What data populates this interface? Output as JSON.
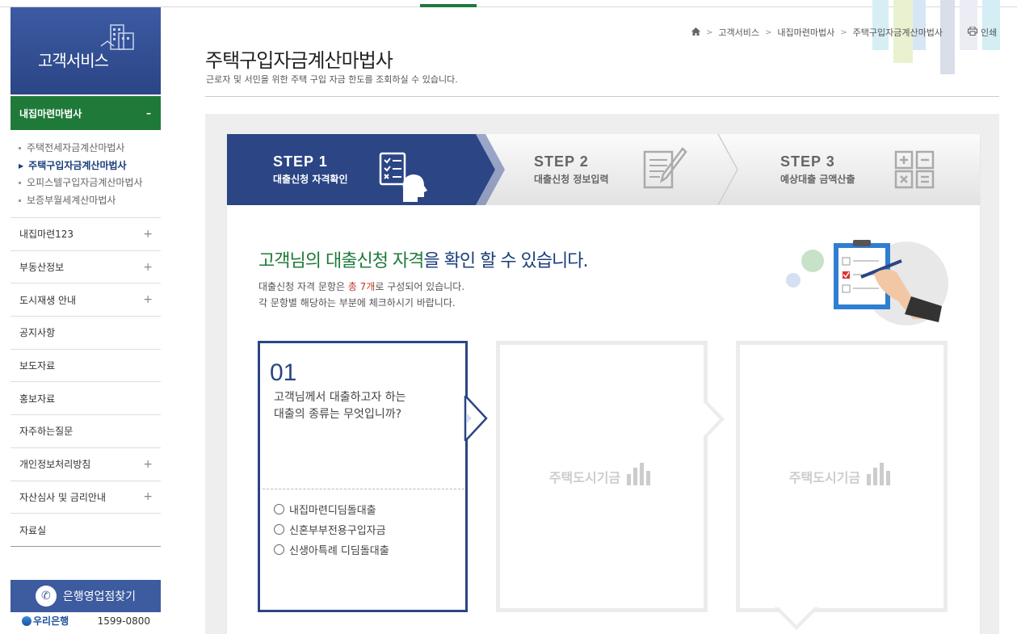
{
  "sidebar": {
    "header_title": "고객서비스",
    "active_section": "내집마련마법사",
    "active_toggle": "–",
    "sub_items": [
      {
        "label": "주택전세자금계산마법사"
      },
      {
        "label": "주택구입자금계산마법사"
      },
      {
        "label": "오피스텔구입자금계산마법사"
      },
      {
        "label": "보증부월세계산마법사"
      }
    ],
    "menu": [
      {
        "label": "내집마련123",
        "expand": "+"
      },
      {
        "label": "부동산정보",
        "expand": "+"
      },
      {
        "label": "도시재생 안내",
        "expand": "+"
      },
      {
        "label": "공지사항",
        "expand": ""
      },
      {
        "label": "보도자료",
        "expand": ""
      },
      {
        "label": "홍보자료",
        "expand": ""
      },
      {
        "label": "자주하는질문",
        "expand": ""
      },
      {
        "label": "개인정보처리방침",
        "expand": "+"
      },
      {
        "label": "자산심사 및 금리안내",
        "expand": "+"
      },
      {
        "label": "자료실",
        "expand": ""
      }
    ],
    "bank_button": "은행영업점찾기",
    "bank_name": "우리은행",
    "bank_phone": "1599-0800"
  },
  "breadcrumb": [
    "고객서비스",
    "내집마련마법사",
    "주택구입자금계산마법사"
  ],
  "print_label": "인쇄",
  "page": {
    "title": "주택구입자금계산마법사",
    "subtitle": "근로자 및 서민을 위한 주택 구입 자금 한도를 조회하실 수 있습니다."
  },
  "steps": [
    {
      "num": "STEP 1",
      "desc": "대출신청 자격확인"
    },
    {
      "num": "STEP 2",
      "desc": "대출신청 정보입력"
    },
    {
      "num": "STEP 3",
      "desc": "예상대출 금액산출"
    }
  ],
  "intro": {
    "headline_1": "고객님의 ",
    "headline_2": "대출신청 자격",
    "headline_3": "을 확인 할 수 있습니다.",
    "line1_a": "대출신청 자격 문항은 ",
    "line1_b": "총 7개",
    "line1_c": "로 구성되어 있습니다.",
    "line2": "각 문항별 해당하는 부분에 체크하시기 바랍니다."
  },
  "question": {
    "number": "01",
    "text_line1": "고객님께서 대출하고자 하는",
    "text_line2": "대출의 종류는 무엇입니까?",
    "options": [
      "내집마련디딤돌대출",
      "신혼부부전용구입자금",
      "신생아특례 디딤돌대출"
    ]
  },
  "placeholder_text": "주택도시기금",
  "colors": {
    "brand_navy": "#2b4585",
    "brand_green": "#1f7a3a",
    "step_inactive": "#e9e9e9"
  }
}
